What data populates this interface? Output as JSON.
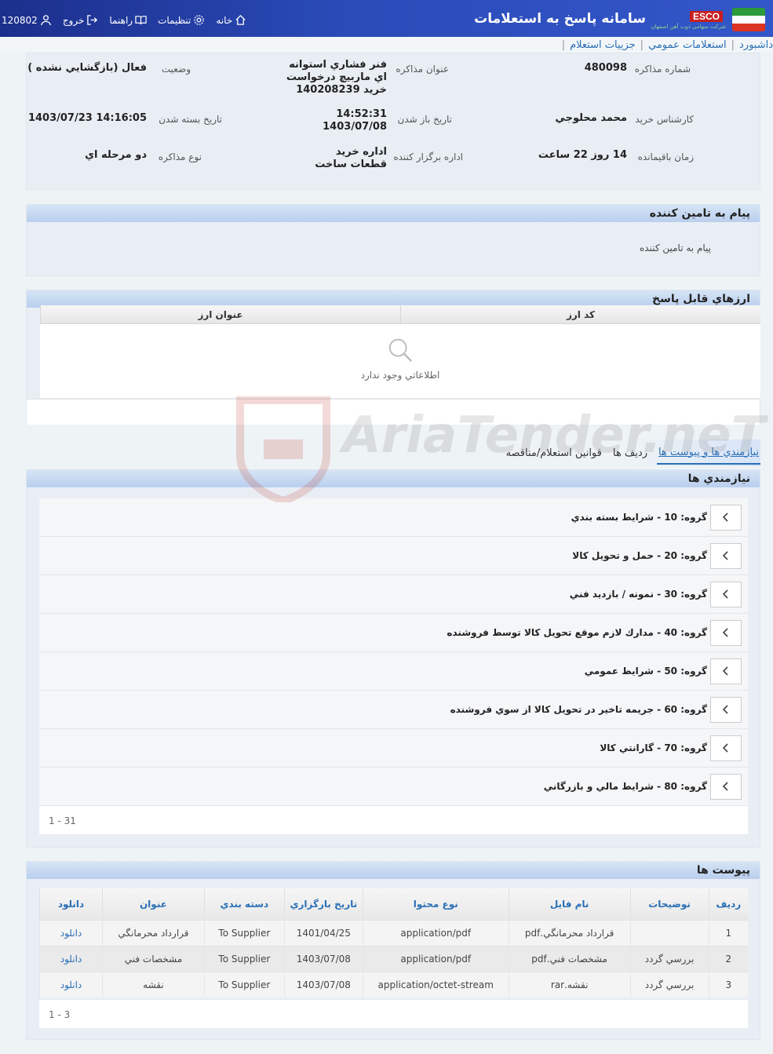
{
  "header": {
    "app_title": "سامانه پاسخ به استعلامات",
    "logo_brand": "ESCO",
    "logo_subtitle": "شرکت سهامی ذوب آهن اصفهان",
    "nav": {
      "home": "خانه",
      "settings": "تنظيمات",
      "help": "راهنما",
      "logout": "خروج",
      "user": "120802"
    }
  },
  "breadcrumb": [
    "داشبورد",
    "استعلامات عمومي",
    "جزييات استعلام"
  ],
  "info": {
    "number_label": "شماره مذاکره",
    "number": "480098",
    "title_label": "عنوان مذاکره",
    "title": "فنر فشاري استوانه اي ماربيچ درخواست خريد 140208239",
    "status_label": "وضعيت",
    "status": "فعال (بازگشايي نشده )",
    "expert_label": "کارشناس خريد",
    "expert": "محمد محلوجي",
    "open_label": "تاريخ باز شدن",
    "open_time": "14:52:31",
    "open_date": "1403/07/08",
    "close_label": "تاريخ بسته شدن",
    "close": "1403/07/23 14:16:05",
    "remain_label": "زمان باقيمانده",
    "remain": "14 روز 22 ساعت",
    "org_label": "اداره برگزار کننده",
    "org": "اداره خريد قطعات ساخت",
    "type_label": "نوع مذاکره",
    "type": "دو مرحله اي"
  },
  "message": {
    "heading": "پيام به تامين کننده",
    "body": "پيام به تامين کننده"
  },
  "currencies": {
    "heading": "ارزهاي قابل پاسخ",
    "col_code": "کد ارز",
    "col_title": "عنوان ارز",
    "empty_text": "اطلاعاتي وجود ندارد"
  },
  "tabs": [
    "نيازمندي ها و پيوست ها",
    "رديف ها",
    "قوانين استعلام/مناقصه"
  ],
  "requirements": {
    "heading": "نيازمندي ها",
    "items": [
      "گروه: 10 - شرايط بسته بندي",
      "گروه: 20 - حمل و تحويل کالا",
      "گروه: 30 - نمونه / بازديد فني",
      "گروه: 40 - مدارك لازم موقع تحويل كالا توسط فروشنده",
      "گروه: 50 - شرايط عمومي",
      "گروه: 60 - جريمه تاخير در تحويل کالا از سوي فروشنده",
      "گروه: 70 - گارانتي کالا",
      "گروه: 80 - شرايط مالي و بازرگاني"
    ],
    "pager": "1 - 31"
  },
  "attachments": {
    "heading": "پيوست ها",
    "columns": [
      "رديف",
      "توضيحات",
      "نام فايل",
      "نوع محتوا",
      "تاريخ بارگزاري",
      "دسته بندي",
      "عنوان",
      "دانلود"
    ],
    "rows": [
      [
        "1",
        "",
        "قرارداد محرمانگي.pdf",
        "application/pdf",
        "1401/04/25",
        "To Supplier",
        "قرارداد محرمانگي",
        "دانلود"
      ],
      [
        "2",
        "بررسي گردد",
        "مشخصات فني.pdf",
        "application/pdf",
        "1403/07/08",
        "To Supplier",
        "مشخصات فني",
        "دانلود"
      ],
      [
        "3",
        "بررسي گردد",
        "نقشه.rar",
        "application/octet-stream",
        "1403/07/08",
        "To Supplier",
        "نقشه",
        "دانلود"
      ]
    ],
    "pager": "1 - 3"
  },
  "watermark": "AriaTender.neT"
}
